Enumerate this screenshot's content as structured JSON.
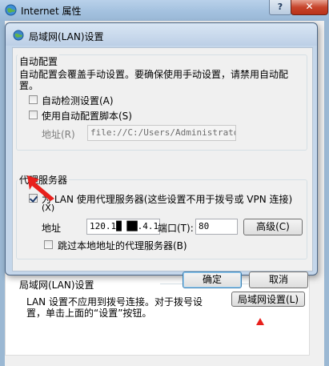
{
  "outer_window": {
    "title": "Internet 属性",
    "help_label": "?",
    "close_label": "✕",
    "lan_group": {
      "title": "局域网(LAN)设置",
      "description_line1": "LAN 设置不应用到拨号连接。对于拨号设",
      "description_line2": "置，单击上面的“设置”按钮。",
      "button_label": "局域网设置(L)"
    }
  },
  "dialog": {
    "title": "局域网(LAN)设置",
    "auto_config": {
      "group_title": "自动配置",
      "description_line1": "自动配置会覆盖手动设置。要确保使用手动设置，请禁用自动配",
      "description_line2": "置。",
      "auto_detect_label": "自动检测设置(A)",
      "auto_detect_checked": false,
      "use_script_label": "使用自动配置脚本(S)",
      "use_script_checked": false,
      "address_label": "地址(R)",
      "address_value": "file://C:/Users/Administrator/"
    },
    "proxy": {
      "group_title": "代理服务器",
      "use_proxy_label_line1": "为 LAN 使用代理服务器(这些设置不用于拨号或 VPN 连接)",
      "use_proxy_label_line2": "(X)",
      "use_proxy_checked": true,
      "address_label": "地址",
      "address_value": "120.1█  ██.4.1",
      "port_label": "端口(T):",
      "port_value": "80",
      "advanced_label": "高级(C)",
      "bypass_label": "跳过本地地址的代理服务器(B)",
      "bypass_checked": false
    },
    "ok_label": "确定",
    "cancel_label": "取消"
  },
  "colors": {
    "annotation_red": "#e8201c",
    "dialog_frame": "#c4d6ea",
    "window_bg": "#f0f0f0"
  }
}
